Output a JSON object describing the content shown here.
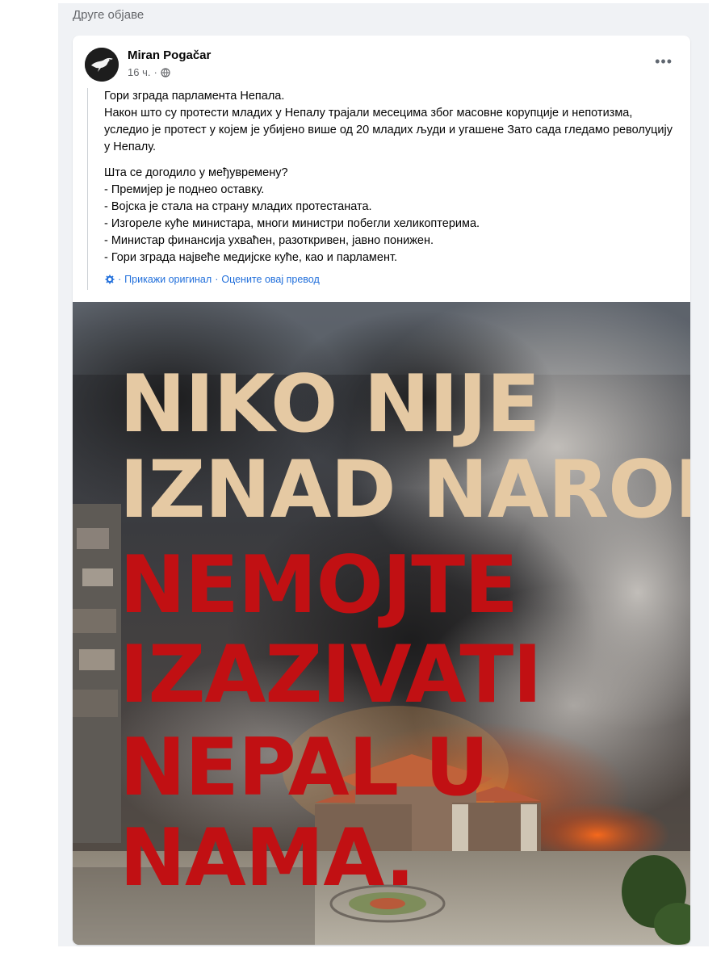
{
  "section": {
    "title": "Друге објаве"
  },
  "post": {
    "author": "Miran Pogačar",
    "time": "16 ч.",
    "dot": "·",
    "paragraphs": [
      "Гори зграда парламента Непала.",
      "Након што су протести младих у Непалу трајали месецима због масовне корупције и непотизма, уследио је протест у којем је убијено више од 20 младих људи и угашене Зато сада гледамо револуцију у Непалу.",
      "Шта се догодило у међувремену?",
      "- Премијер је поднео оставку.",
      "- Војска је стала на страну младих протестаната.",
      "- Изгореле куће министара, многи министри побегли хеликоптерима.",
      "- Министар финансија ухваћен, разоткривен, јавно понижен.",
      "- Гори зграда највеће медијске куће, као и парламент."
    ],
    "translation": {
      "show_original": "Прикажи оригинал",
      "separator": "·",
      "rate": "Оцените овај превод"
    },
    "image_text": {
      "line1": "NIKO NIJE",
      "line2": "IZNAD NARODA.",
      "line3": "NEMOJTE",
      "line4": "IZAZIVATI",
      "line5": "NEPAL U",
      "line6": "NAMA."
    },
    "colors": {
      "cream_text": "#e5c9a3",
      "red_text": "#c11013",
      "link": "#216fdb"
    },
    "icons": {
      "globe": "globe-icon",
      "gear": "gear-icon",
      "more": "more-options-icon",
      "avatar": "dove-logo"
    }
  }
}
